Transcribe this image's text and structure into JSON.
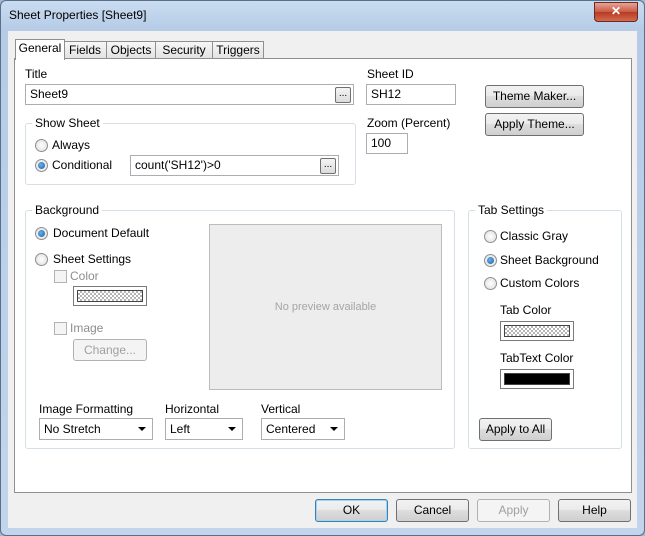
{
  "window": {
    "title": "Sheet Properties [Sheet9]",
    "close_glyph": "✕"
  },
  "tabs": [
    {
      "label": "General"
    },
    {
      "label": "Fields"
    },
    {
      "label": "Objects"
    },
    {
      "label": "Security"
    },
    {
      "label": "Triggers"
    }
  ],
  "general": {
    "title_label": "Title",
    "title_value": "Sheet9",
    "sheet_id_label": "Sheet ID",
    "sheet_id_value": "SH12",
    "theme_maker": "Theme Maker...",
    "apply_theme": "Apply Theme...",
    "show_sheet": {
      "group_title": "Show Sheet",
      "always": "Always",
      "conditional": "Conditional",
      "condition_value": "count('SH12')>0",
      "selected": "conditional"
    },
    "zoom_label": "Zoom (Percent)",
    "zoom_value": "100",
    "browse": "..."
  },
  "background": {
    "group_title": "Background",
    "document_default": "Document Default",
    "sheet_settings": "Sheet Settings",
    "color": "Color",
    "image": "Image",
    "change": "Change...",
    "preview_text": "No preview available",
    "selected": "document_default"
  },
  "image_formatting": {
    "label": "Image Formatting",
    "value": "No Stretch"
  },
  "horizontal": {
    "label": "Horizontal",
    "value": "Left"
  },
  "vertical": {
    "label": "Vertical",
    "value": "Centered"
  },
  "tab_settings": {
    "group_title": "Tab Settings",
    "classic_gray": "Classic Gray",
    "sheet_background": "Sheet Background",
    "custom_colors": "Custom Colors",
    "selected": "sheet_background",
    "tab_color_label": "Tab Color",
    "tab_text_color_label": "TabText Color",
    "tab_text_color_hex": "#000000",
    "apply_to_all": "Apply to All"
  },
  "footer": {
    "ok": "OK",
    "cancel": "Cancel",
    "apply": "Apply",
    "help": "Help"
  }
}
